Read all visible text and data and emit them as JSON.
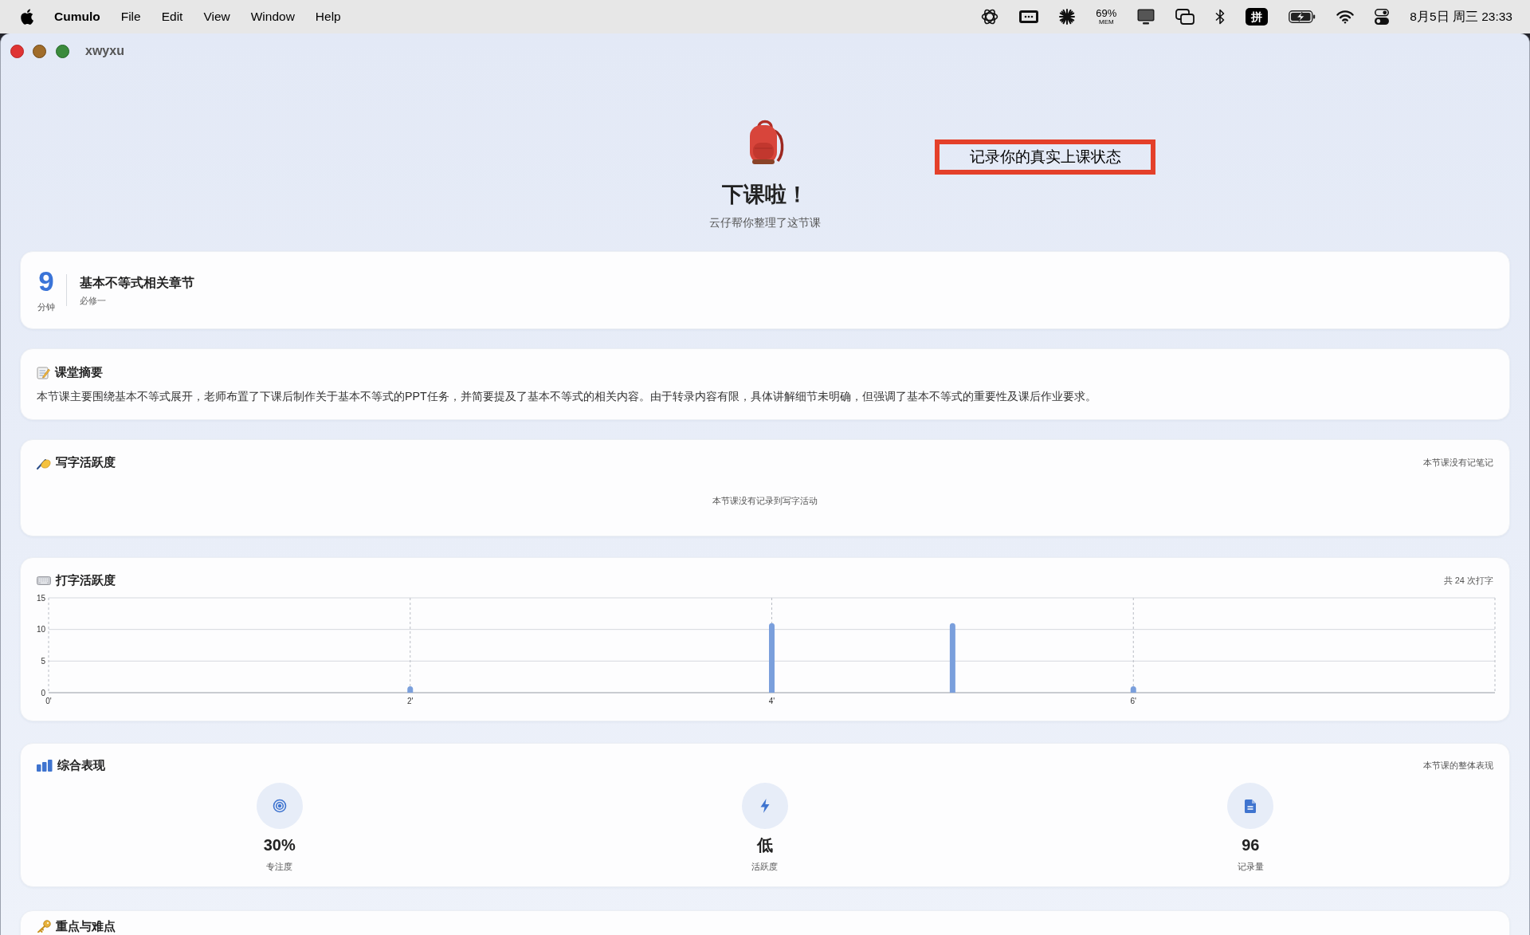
{
  "menu_bar": {
    "app_name": "Cumulo",
    "menus": [
      "File",
      "Edit",
      "View",
      "Window",
      "Help"
    ],
    "memory_percent": "69%",
    "memory_label": "MEM",
    "input_method": "拼",
    "clock": "8月5日 周三 23:33"
  },
  "window": {
    "title": "xwyxu"
  },
  "header": {
    "title": "下课啦！",
    "subtitle": "云仔帮你整理了这节课"
  },
  "annotation": {
    "text": "记录你的真实上课状态"
  },
  "lesson": {
    "duration": "9",
    "duration_unit": "分钟",
    "title": "基本不等式相关章节",
    "subtitle": "必修一"
  },
  "summary": {
    "title": "课堂摘要",
    "text": "本节课主要围绕基本不等式展开，老师布置了下课后制作关于基本不等式的PPT任务，并简要提及了基本不等式的相关内容。由于转录内容有限，具体讲解细节未明确，但强调了基本不等式的重要性及课后作业要求。"
  },
  "writing": {
    "title": "写字活跃度",
    "note": "本节课没有记笔记",
    "empty_message": "本节课没有记录到写字活动"
  },
  "typing": {
    "title": "打字活跃度",
    "note": "共 24 次打字",
    "chart_data": {
      "type": "bar",
      "x": [
        2,
        4,
        5,
        6
      ],
      "values": [
        1,
        11,
        11,
        1
      ],
      "xlim": [
        0,
        8
      ],
      "ylim": [
        0,
        15
      ],
      "xticks": [
        {
          "value": 0,
          "label": "0'"
        },
        {
          "value": 2,
          "label": "2'"
        },
        {
          "value": 4,
          "label": "4'"
        },
        {
          "value": 6,
          "label": "6'"
        }
      ],
      "yticks": [
        0,
        5,
        10,
        15
      ],
      "grid": true
    }
  },
  "performance": {
    "title": "综合表现",
    "note": "本节课的整体表现",
    "metrics": [
      {
        "kind": "focus",
        "value": "30%",
        "label": "专注度"
      },
      {
        "kind": "activity",
        "value": "低",
        "label": "活跃度"
      },
      {
        "kind": "records",
        "value": "96",
        "label": "记录量"
      }
    ]
  },
  "key_points": {
    "title": "重点与难点"
  }
}
